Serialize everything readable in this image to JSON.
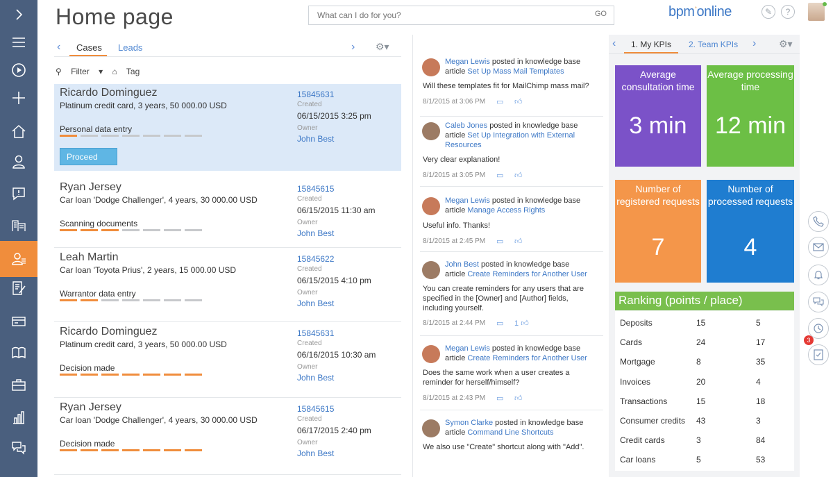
{
  "sidebar": {
    "items": [
      {
        "icon": "chevron-right-icon"
      },
      {
        "icon": "menu-icon"
      },
      {
        "icon": "play-icon"
      },
      {
        "icon": "plus-icon"
      },
      {
        "icon": "home-icon"
      },
      {
        "icon": "contact-icon"
      },
      {
        "icon": "feedback-icon"
      },
      {
        "icon": "accounts-icon"
      },
      {
        "icon": "cases-icon",
        "active": true
      },
      {
        "icon": "edit-icon"
      },
      {
        "icon": "card-icon"
      },
      {
        "icon": "book-icon"
      },
      {
        "icon": "briefcase-icon"
      },
      {
        "icon": "chart-icon"
      },
      {
        "icon": "chat-icon"
      }
    ],
    "colors": {
      "bg": "#4a5f7e",
      "active": "#f08d3c"
    }
  },
  "header": {
    "title": "Home page",
    "search_placeholder": "What can I do for you?",
    "search_go": "GO",
    "logo_left": "bpm",
    "logo_right": "online",
    "settings_icon": "wrench-icon",
    "help_label": "?"
  },
  "cases_panel": {
    "tabs": [
      "Cases",
      "Leads"
    ],
    "toolbar": {
      "filter": "Filter",
      "tag": "Tag"
    },
    "created_label": "Created",
    "owner_label": "Owner",
    "proceed_label": "Proceed",
    "cases": [
      {
        "name": "Ricardo Dominguez",
        "desc": "Platinum credit card, 3 years, 50 000.00 USD",
        "stage": "Personal data entry",
        "stage_done": 1,
        "stage_total": 7,
        "number": "15845631",
        "date": "06/15/2015 3:25 pm",
        "owner": "John Best",
        "selected": true
      },
      {
        "name": "Ryan Jersey",
        "desc": "Car loan 'Dodge Challenger', 4 years, 30 000.00 USD",
        "stage": "Scanning documents",
        "stage_done": 3,
        "stage_total": 7,
        "number": "15845615",
        "date": "06/15/2015 11:30 am",
        "owner": "John Best"
      },
      {
        "name": "Leah Martin",
        "desc": "Car loan 'Toyota Prius', 2 years, 15 000.00 USD",
        "stage": "Warrantor data entry",
        "stage_done": 2,
        "stage_total": 7,
        "number": "15845622",
        "date": "06/15/2015 4:10 pm",
        "owner": "John Best"
      },
      {
        "name": "Ricardo Dominguez",
        "desc": "Platinum credit card, 3 years, 50 000.00 USD",
        "stage": "Decision made",
        "stage_done": 7,
        "stage_total": 7,
        "number": "15845631",
        "date": "06/16/2015 10:30 am",
        "owner": "John Best"
      },
      {
        "name": "Ryan Jersey",
        "desc": "Car loan 'Dodge Challenger', 4 years, 30 000.00 USD",
        "stage": "Decision made",
        "stage_done": 7,
        "stage_total": 7,
        "number": "15845615",
        "date": "06/17/2015 2:40 pm",
        "owner": "John Best"
      }
    ]
  },
  "feed": {
    "posts": [
      {
        "author": "Megan Lewis",
        "action": "posted in knowledge base",
        "prefix": "article",
        "article": "Set Up Mass Mail Templates",
        "body": "Will these templates fit for MailChimp mass mail?",
        "time": "8/1/2015 at 3:06 PM",
        "likes": "",
        "avatar": "female"
      },
      {
        "author": "Caleb Jones",
        "action": "posted in knowledge base",
        "prefix": "article",
        "article": "Set Up Integration with External Resources",
        "body": "Very clear explanation!",
        "time": "8/1/2015 at 3:05 PM",
        "likes": "",
        "avatar": "male"
      },
      {
        "author": "Megan Lewis",
        "action": "posted in knowledge base",
        "prefix": "article",
        "article": "Manage Access Rights",
        "body": "Useful info. Thanks!",
        "time": "8/1/2015 at 2:45 PM",
        "likes": "",
        "avatar": "female"
      },
      {
        "author": "John Best",
        "action": "posted in knowledge base",
        "prefix": "article",
        "article": "Create Reminders for Another User",
        "body": "You can create reminders for any users that are specified in the [Owner] and [Author] fields, including yourself.",
        "time": "8/1/2015 at 2:44 PM",
        "likes": "1",
        "avatar": "male"
      },
      {
        "author": "Megan Lewis",
        "action": "posted in knowledge base",
        "prefix": "article",
        "article": "Create Reminders for Another User",
        "body": "Does the same work when a user creates a reminder for herself/himself?",
        "time": "8/1/2015 at 2:43 PM",
        "likes": "",
        "avatar": "female"
      },
      {
        "author": "Symon Clarke",
        "action": "posted in knowledge base",
        "prefix": "article",
        "article": "Command Line Shortcuts",
        "body": "We also use \"Create\" shortcut along with \"Add\".",
        "time": "",
        "likes": "",
        "avatar": "male"
      }
    ]
  },
  "kpi": {
    "tabs": [
      "1. My KPIs",
      "2. Team KPIs"
    ],
    "tiles": [
      {
        "title": "Average consultation time",
        "value": "3 min",
        "color": "#7b52c8"
      },
      {
        "title": "Average processing time",
        "value": "12 min",
        "color": "#6cbf45"
      },
      {
        "title": "Number of registered requests",
        "value": "7",
        "color": "#f4964a"
      },
      {
        "title": "Number of processed requests",
        "value": "4",
        "color": "#1f7dd0"
      }
    ],
    "ranking": {
      "title": "Ranking (points / place)",
      "rows": [
        {
          "name": "Deposits",
          "points": "15",
          "place": "5"
        },
        {
          "name": "Cards",
          "points": "24",
          "place": "17"
        },
        {
          "name": "Mortgage",
          "points": "8",
          "place": "35"
        },
        {
          "name": "Invoices",
          "points": "20",
          "place": "4"
        },
        {
          "name": "Transactions",
          "points": "15",
          "place": "18"
        },
        {
          "name": "Consumer credits",
          "points": "43",
          "place": "3"
        },
        {
          "name": "Credit cards",
          "points": "3",
          "place": "84"
        },
        {
          "name": "Car loans",
          "points": "5",
          "place": "53"
        }
      ]
    }
  },
  "rail": {
    "buttons": [
      "phone-icon",
      "mail-icon",
      "bell-icon",
      "chat-icon",
      "clock-icon",
      "check-icon"
    ],
    "badge": "3"
  }
}
